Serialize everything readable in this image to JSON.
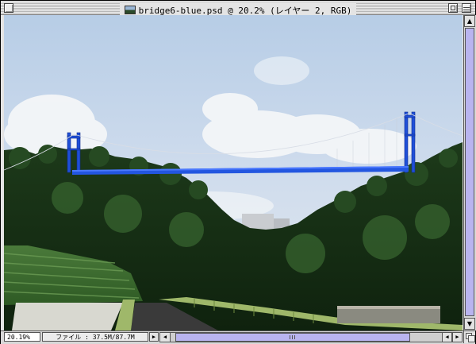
{
  "window": {
    "title": "bridge6-blue.psd @ 20.2% (レイヤー 2, RGB)",
    "document_icon": "photoshop-document-icon"
  },
  "canvas": {
    "content": "photo"
  },
  "status_bar": {
    "zoom_value": "20.19%",
    "document_info": "ファイル : 37.5M/87.7M"
  },
  "scrollbars": {
    "vertical_up_arrow": "▲",
    "vertical_down_arrow": "▼",
    "horizontal_left_arrow": "◀",
    "horizontal_right_arrow": "▶",
    "info_menu_arrow": "▶"
  },
  "colors": {
    "scroll_accent": "#b9b4ef",
    "bridge_blue": "#1f4fd8"
  }
}
